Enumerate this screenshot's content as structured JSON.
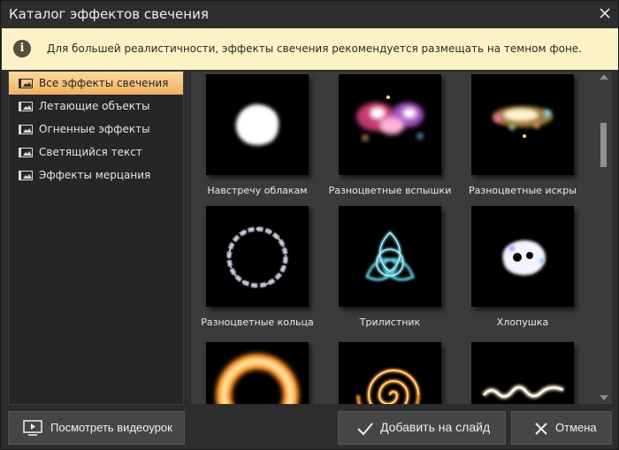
{
  "window": {
    "title": "Каталог эффектов свечения"
  },
  "info": {
    "text": "Для большей реалистичности, эффекты свечения рекомендуется размещать на темном фоне."
  },
  "sidebar": {
    "items": [
      {
        "label": "Все эффекты свечения",
        "active": true
      },
      {
        "label": "Летающие объекты"
      },
      {
        "label": "Огненные эффекты"
      },
      {
        "label": "Светящийся текст"
      },
      {
        "label": "Эффекты мерцания"
      }
    ]
  },
  "gallery": {
    "items": [
      {
        "label": "Навстречу облакам"
      },
      {
        "label": "Разноцветные вспышки"
      },
      {
        "label": "Разноцветные искры"
      },
      {
        "label": "Разноцветные кольца"
      },
      {
        "label": "Трилистник"
      },
      {
        "label": "Хлопушка"
      },
      {
        "label": ""
      },
      {
        "label": ""
      },
      {
        "label": ""
      }
    ]
  },
  "buttons": {
    "video": "Посмотреть видеоурок",
    "add": "Добавить на слайд",
    "cancel": "Отмена"
  },
  "colors": {
    "accent": "#f3b666",
    "info_bg": "#fcf2c6"
  }
}
